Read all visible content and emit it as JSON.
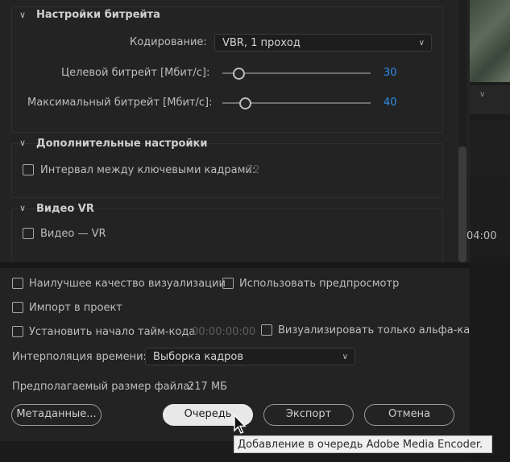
{
  "bitrate": {
    "title": "Настройки битрейта",
    "encoding_label": "Кодирование:",
    "encoding_value": "VBR, 1 проход",
    "target_label": "Целевой битрейт [Мбит/с]:",
    "target_value": "30",
    "max_label": "Максимальный битрейт [Мбит/с]:",
    "max_value": "40"
  },
  "advanced": {
    "title": "Дополнительные настройки",
    "keyframe_label": "Интервал между ключевыми кадрами:",
    "keyframe_value": "72"
  },
  "vr": {
    "title": "Видео VR",
    "vr_label": "Видео — VR"
  },
  "options": {
    "max_quality": "Наилучшее качество визуализации",
    "use_previews": "Использовать предпросмотр",
    "import_project": "Импорт в проект",
    "start_timecode": "Установить начало тайм-кода",
    "timecode_value": "00:00:00:00",
    "alpha_only": "Визуализировать только альфа-кана",
    "time_interp_label": "Интерполяция времени:",
    "time_interp_value": "Выборка кадров",
    "filesize_label": "Предполагаемый размер файла:",
    "filesize_value": "217 МБ"
  },
  "buttons": {
    "metadata": "Метаданные...",
    "queue": "Очередь",
    "export": "Экспорт",
    "cancel": "Отмена"
  },
  "tooltip": "Добавление в очередь Adobe Media Encoder.",
  "timeline": {
    "timecode": "04:00"
  },
  "colors": {
    "accent": "#2d8ceb",
    "background": "#232323"
  }
}
